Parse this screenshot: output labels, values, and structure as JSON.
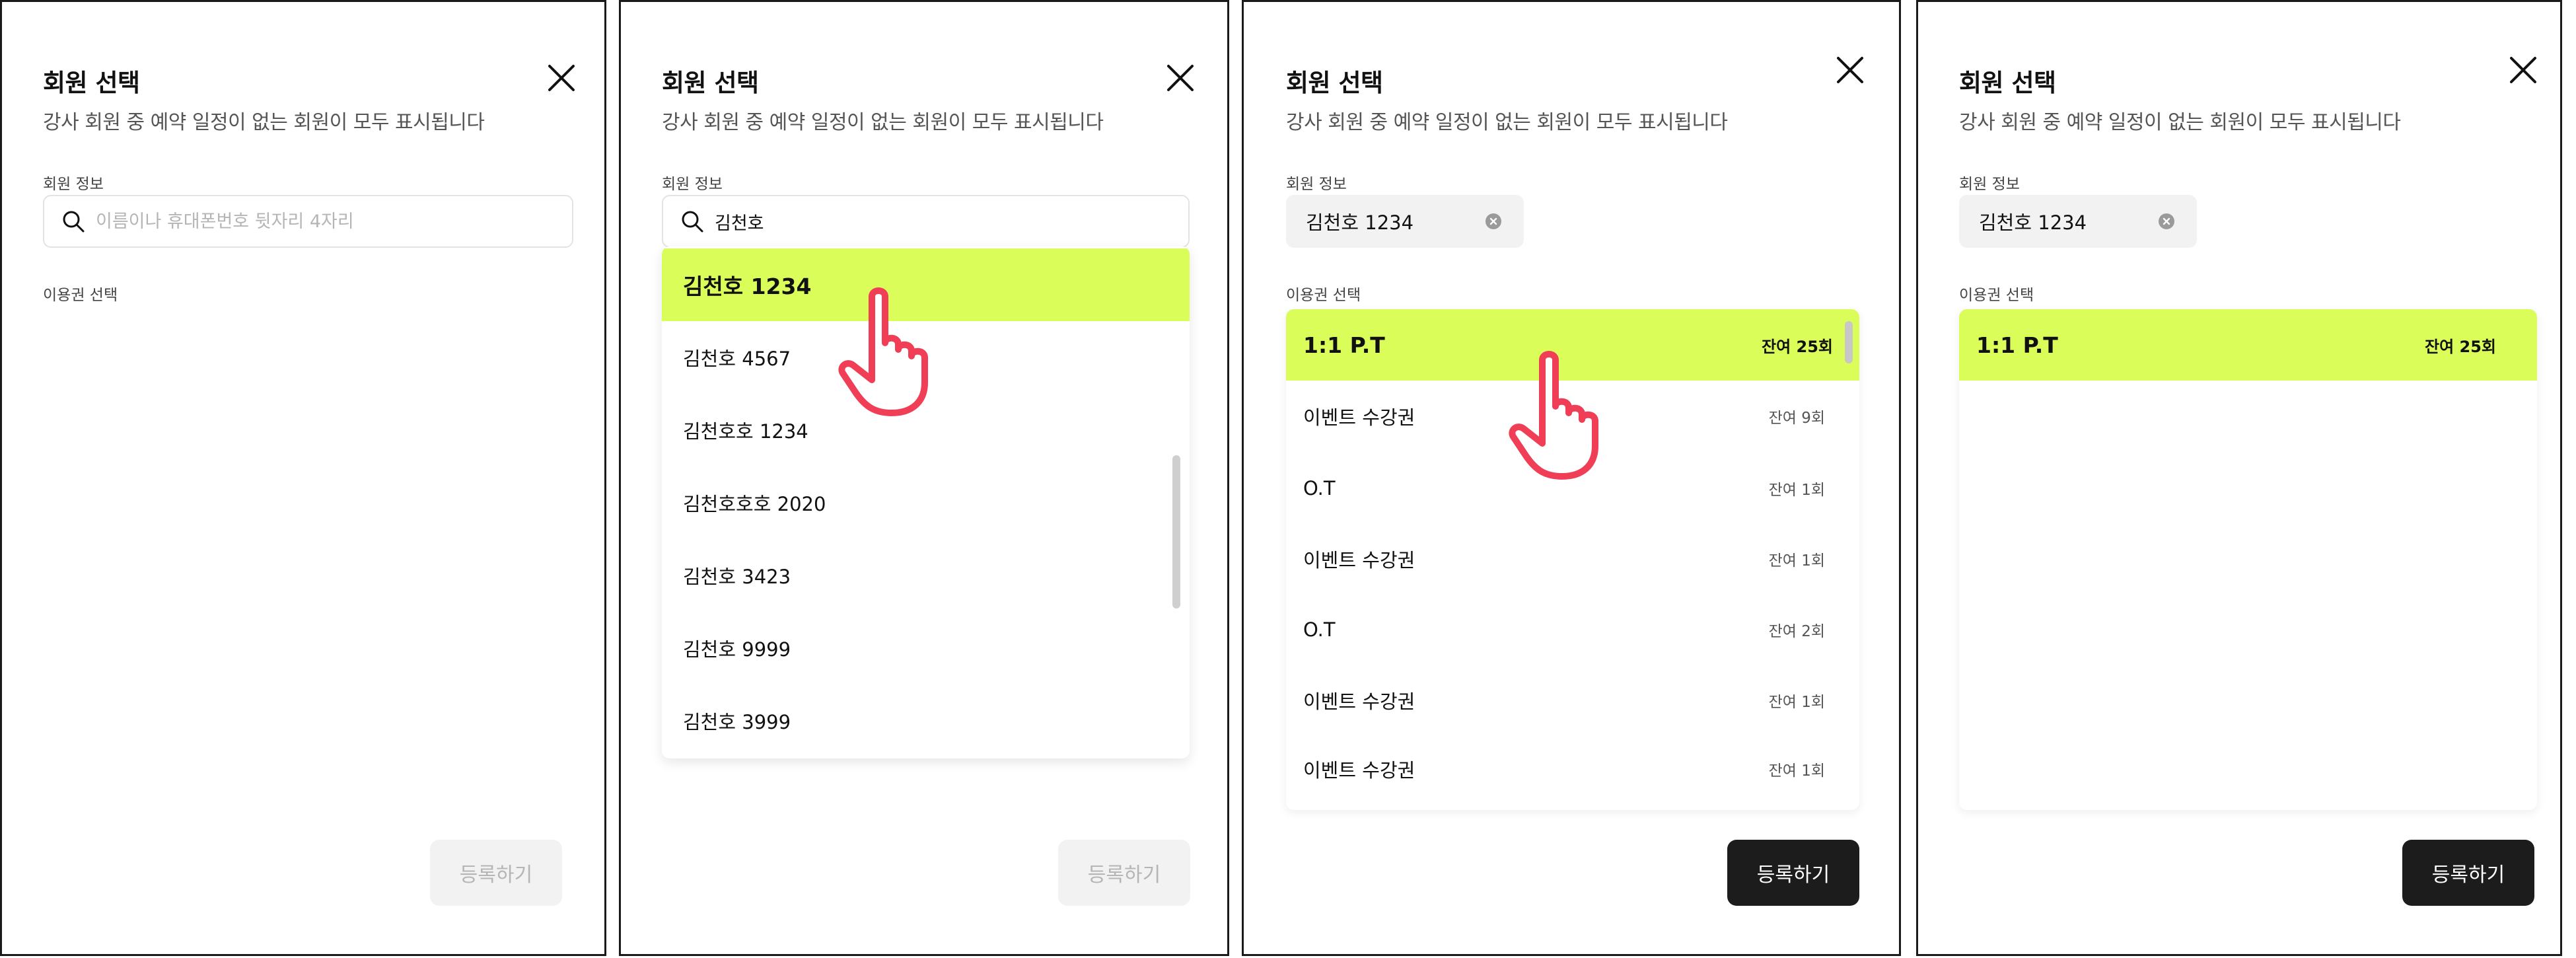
{
  "modal": {
    "title": "회원 선택",
    "subtitle": "강사 회원 중 예약 일정이 없는 회원이 모두 표시됩니다",
    "member_info_label": "회원 정보",
    "ticket_select_label": "이용권 선택",
    "submit_label": "등록하기"
  },
  "search": {
    "placeholder": "이름이나 휴대폰번호 뒷자리 4자리",
    "typed_value": "김천호"
  },
  "dropdown": {
    "results": [
      "김천호 1234",
      "김천호 4567",
      "김천호호 1234",
      "김천호호호 2020",
      "김천호 3423",
      "김천호 9999",
      "김천호 3999"
    ]
  },
  "selected_member": "김천호 1234",
  "tickets": [
    {
      "name": "1:1 P.T",
      "remaining": "잔여 25회"
    },
    {
      "name": "이벤트 수강권",
      "remaining": "잔여 9회"
    },
    {
      "name": "O.T",
      "remaining": "잔여 1회"
    },
    {
      "name": "이벤트 수강권",
      "remaining": "잔여 1회"
    },
    {
      "name": "O.T",
      "remaining": "잔여 2회"
    },
    {
      "name": "이벤트 수강권",
      "remaining": "잔여 1회"
    },
    {
      "name": "이벤트 수강권",
      "remaining": "잔여 1회"
    }
  ],
  "icons": {
    "close": "close-icon",
    "search": "search-icon",
    "clear": "clear-icon",
    "cursor": "hand-pointer-icon"
  },
  "colors": {
    "highlight": "#dbfd5a",
    "primary_button": "#1c1c1c",
    "disabled_button": "#f2f2f2",
    "cursor": "#f03e56"
  }
}
